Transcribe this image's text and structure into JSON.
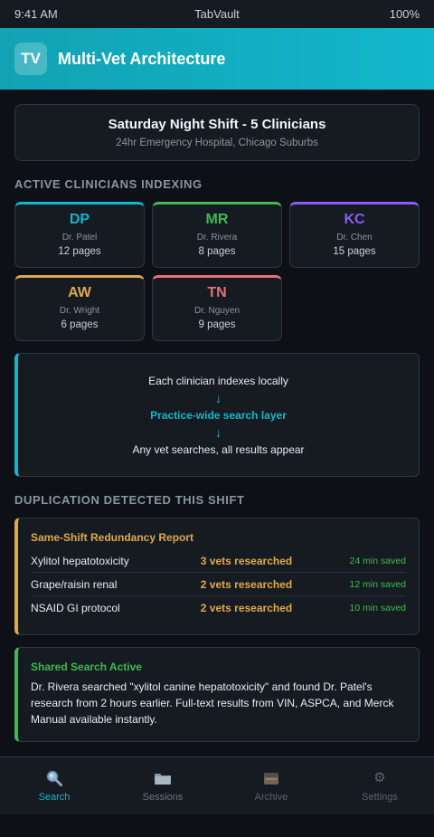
{
  "status_bar": {
    "time": "9:41 AM",
    "app": "TabVault",
    "battery": "100%"
  },
  "header": {
    "logo": "TV",
    "title": "Multi-Vet Architecture"
  },
  "shift": {
    "title": "Saturday Night Shift - 5 Clinicians",
    "subtitle": "24hr Emergency Hospital, Chicago Suburbs"
  },
  "clinicians_section": {
    "label": "ACTIVE CLINICIANS INDEXING",
    "items": [
      {
        "initials": "DP",
        "name": "Dr. Patel",
        "pages": "12 pages",
        "color": "#12b5c9"
      },
      {
        "initials": "MR",
        "name": "Dr. Rivera",
        "pages": "8 pages",
        "color": "#3fb950"
      },
      {
        "initials": "KC",
        "name": "Dr. Chen",
        "pages": "15 pages",
        "color": "#8b5cf6"
      },
      {
        "initials": "AW",
        "name": "Dr. Wright",
        "pages": "6 pages",
        "color": "#e0a84a"
      },
      {
        "initials": "TN",
        "name": "Dr. Nguyen",
        "pages": "9 pages",
        "color": "#e5707a"
      }
    ]
  },
  "flow": {
    "step1": "Each clinician indexes locally",
    "step2": "Practice-wide search layer",
    "step3": "Any vet searches, all results appear",
    "arrow": "↓"
  },
  "duplication_section": {
    "label": "DUPLICATION DETECTED THIS SHIFT",
    "report_title": "Same-Shift Redundancy Report",
    "rows": [
      {
        "topic": "Xylitol hepatotoxicity",
        "count": "3 vets researched",
        "saved": "24 min saved"
      },
      {
        "topic": "Grape/raisin renal",
        "count": "2 vets researched",
        "saved": "12 min saved"
      },
      {
        "topic": "NSAID GI protocol",
        "count": "2 vets researched",
        "saved": "10 min saved"
      }
    ]
  },
  "shared": {
    "title": "Shared Search Active",
    "body": "Dr. Rivera searched \"xylitol canine hepatotoxicity\" and found Dr. Patel's research from 2 hours earlier. Full-text results from VIN, ASPCA, and Merck Manual available instantly."
  },
  "tabs": [
    {
      "label": "Search",
      "icon": "search-icon"
    },
    {
      "label": "Sessions",
      "icon": "folder-icon"
    },
    {
      "label": "Archive",
      "icon": "archive-icon"
    },
    {
      "label": "Settings",
      "icon": "gear-icon"
    }
  ],
  "colors": {
    "accent": "#12b5c9",
    "warning": "#e0a84a",
    "success": "#3fb950",
    "background": "#0d1117",
    "card": "#161b22"
  }
}
